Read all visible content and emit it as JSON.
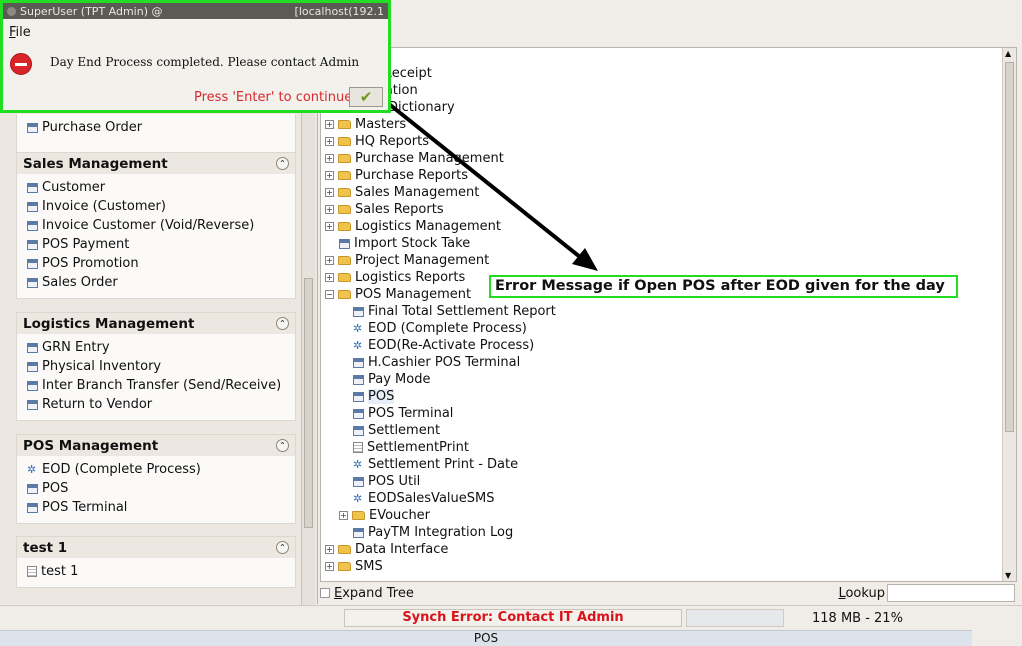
{
  "dialog": {
    "title": "SuperUser (TPT Admin) @",
    "host": "[localhost(192.1",
    "menu_file": "File",
    "message": "Day End Process completed. Please contact Admin",
    "continue_text": "Press 'Enter' to continue"
  },
  "sidebar": {
    "top_item": "Purchase Order",
    "cards": [
      {
        "title": "Sales Management",
        "items": [
          {
            "label": "Customer",
            "icon": "form"
          },
          {
            "label": "Invoice (Customer)",
            "icon": "form"
          },
          {
            "label": "Invoice Customer (Void/Reverse)",
            "icon": "form"
          },
          {
            "label": "POS Payment",
            "icon": "form"
          },
          {
            "label": "POS Promotion",
            "icon": "form"
          },
          {
            "label": "Sales Order",
            "icon": "form"
          }
        ]
      },
      {
        "title": "Logistics Management",
        "items": [
          {
            "label": "GRN Entry",
            "icon": "form"
          },
          {
            "label": "Physical Inventory",
            "icon": "form"
          },
          {
            "label": "Inter Branch Transfer (Send/Receive)",
            "icon": "form"
          },
          {
            "label": "Return to Vendor",
            "icon": "form"
          }
        ]
      },
      {
        "title": "POS Management",
        "items": [
          {
            "label": "EOD (Complete Process)",
            "icon": "gear"
          },
          {
            "label": "POS",
            "icon": "form"
          },
          {
            "label": "POS Terminal",
            "icon": "form"
          }
        ]
      },
      {
        "title": "test 1",
        "items": [
          {
            "label": "test 1",
            "icon": "doc"
          }
        ]
      }
    ]
  },
  "tree": {
    "partial_items": [
      "ce Receipt",
      "istration",
      "ation Dictionary"
    ],
    "items": [
      {
        "label": "Masters",
        "level": 0,
        "type": "folder",
        "expanded": false
      },
      {
        "label": "HQ Reports",
        "level": 0,
        "type": "folder",
        "expanded": false
      },
      {
        "label": "Purchase Management",
        "level": 0,
        "type": "folder",
        "expanded": false
      },
      {
        "label": "Purchase Reports",
        "level": 0,
        "type": "folder",
        "expanded": false
      },
      {
        "label": "Sales Management",
        "level": 0,
        "type": "folder",
        "expanded": false
      },
      {
        "label": "Sales Reports",
        "level": 0,
        "type": "folder",
        "expanded": false
      },
      {
        "label": "Logistics Management",
        "level": 0,
        "type": "folder",
        "expanded": false
      },
      {
        "label": "Import Stock Take",
        "level": 0,
        "type": "form",
        "expanded": false
      },
      {
        "label": "Project Management",
        "level": 0,
        "type": "folder",
        "expanded": false
      },
      {
        "label": "Logistics Reports",
        "level": 0,
        "type": "folder",
        "expanded": false
      },
      {
        "label": "POS Management",
        "level": 0,
        "type": "folder-open",
        "expanded": true
      },
      {
        "label": "Final Total Settlement Report",
        "level": 1,
        "type": "form"
      },
      {
        "label": "EOD (Complete Process)",
        "level": 1,
        "type": "gear"
      },
      {
        "label": "EOD(Re-Activate Process)",
        "level": 1,
        "type": "gear"
      },
      {
        "label": "H.Cashier POS Terminal",
        "level": 1,
        "type": "form"
      },
      {
        "label": "Pay Mode",
        "level": 1,
        "type": "form"
      },
      {
        "label": "POS",
        "level": 1,
        "type": "form",
        "selected": true
      },
      {
        "label": "POS Terminal",
        "level": 1,
        "type": "form"
      },
      {
        "label": "Settlement",
        "level": 1,
        "type": "form"
      },
      {
        "label": "SettlementPrint",
        "level": 1,
        "type": "doc"
      },
      {
        "label": "Settlement Print - Date",
        "level": 1,
        "type": "gear"
      },
      {
        "label": "POS Util",
        "level": 1,
        "type": "form"
      },
      {
        "label": "EODSalesValueSMS",
        "level": 1,
        "type": "gear"
      },
      {
        "label": "EVoucher",
        "level": 1,
        "type": "folder",
        "expanded": false
      },
      {
        "label": "PayTM Integration Log",
        "level": 1,
        "type": "form"
      },
      {
        "label": "Data Interface",
        "level": 0,
        "type": "folder",
        "expanded": false
      },
      {
        "label": "SMS",
        "level": 0,
        "type": "folder",
        "expanded": false
      }
    ],
    "expand_tree_label": "Expand Tree",
    "lookup_label": "Lookup"
  },
  "annotation": "Error Message if Open POS after EOD given for the day",
  "status": {
    "synch": "Synch Error: Contact IT Admin",
    "memory": "118 MB - 21%",
    "bottom": "POS"
  },
  "colors": {
    "highlight_border": "#22dd22",
    "error_text": "#d8131a",
    "continue_text": "#d8282e"
  }
}
